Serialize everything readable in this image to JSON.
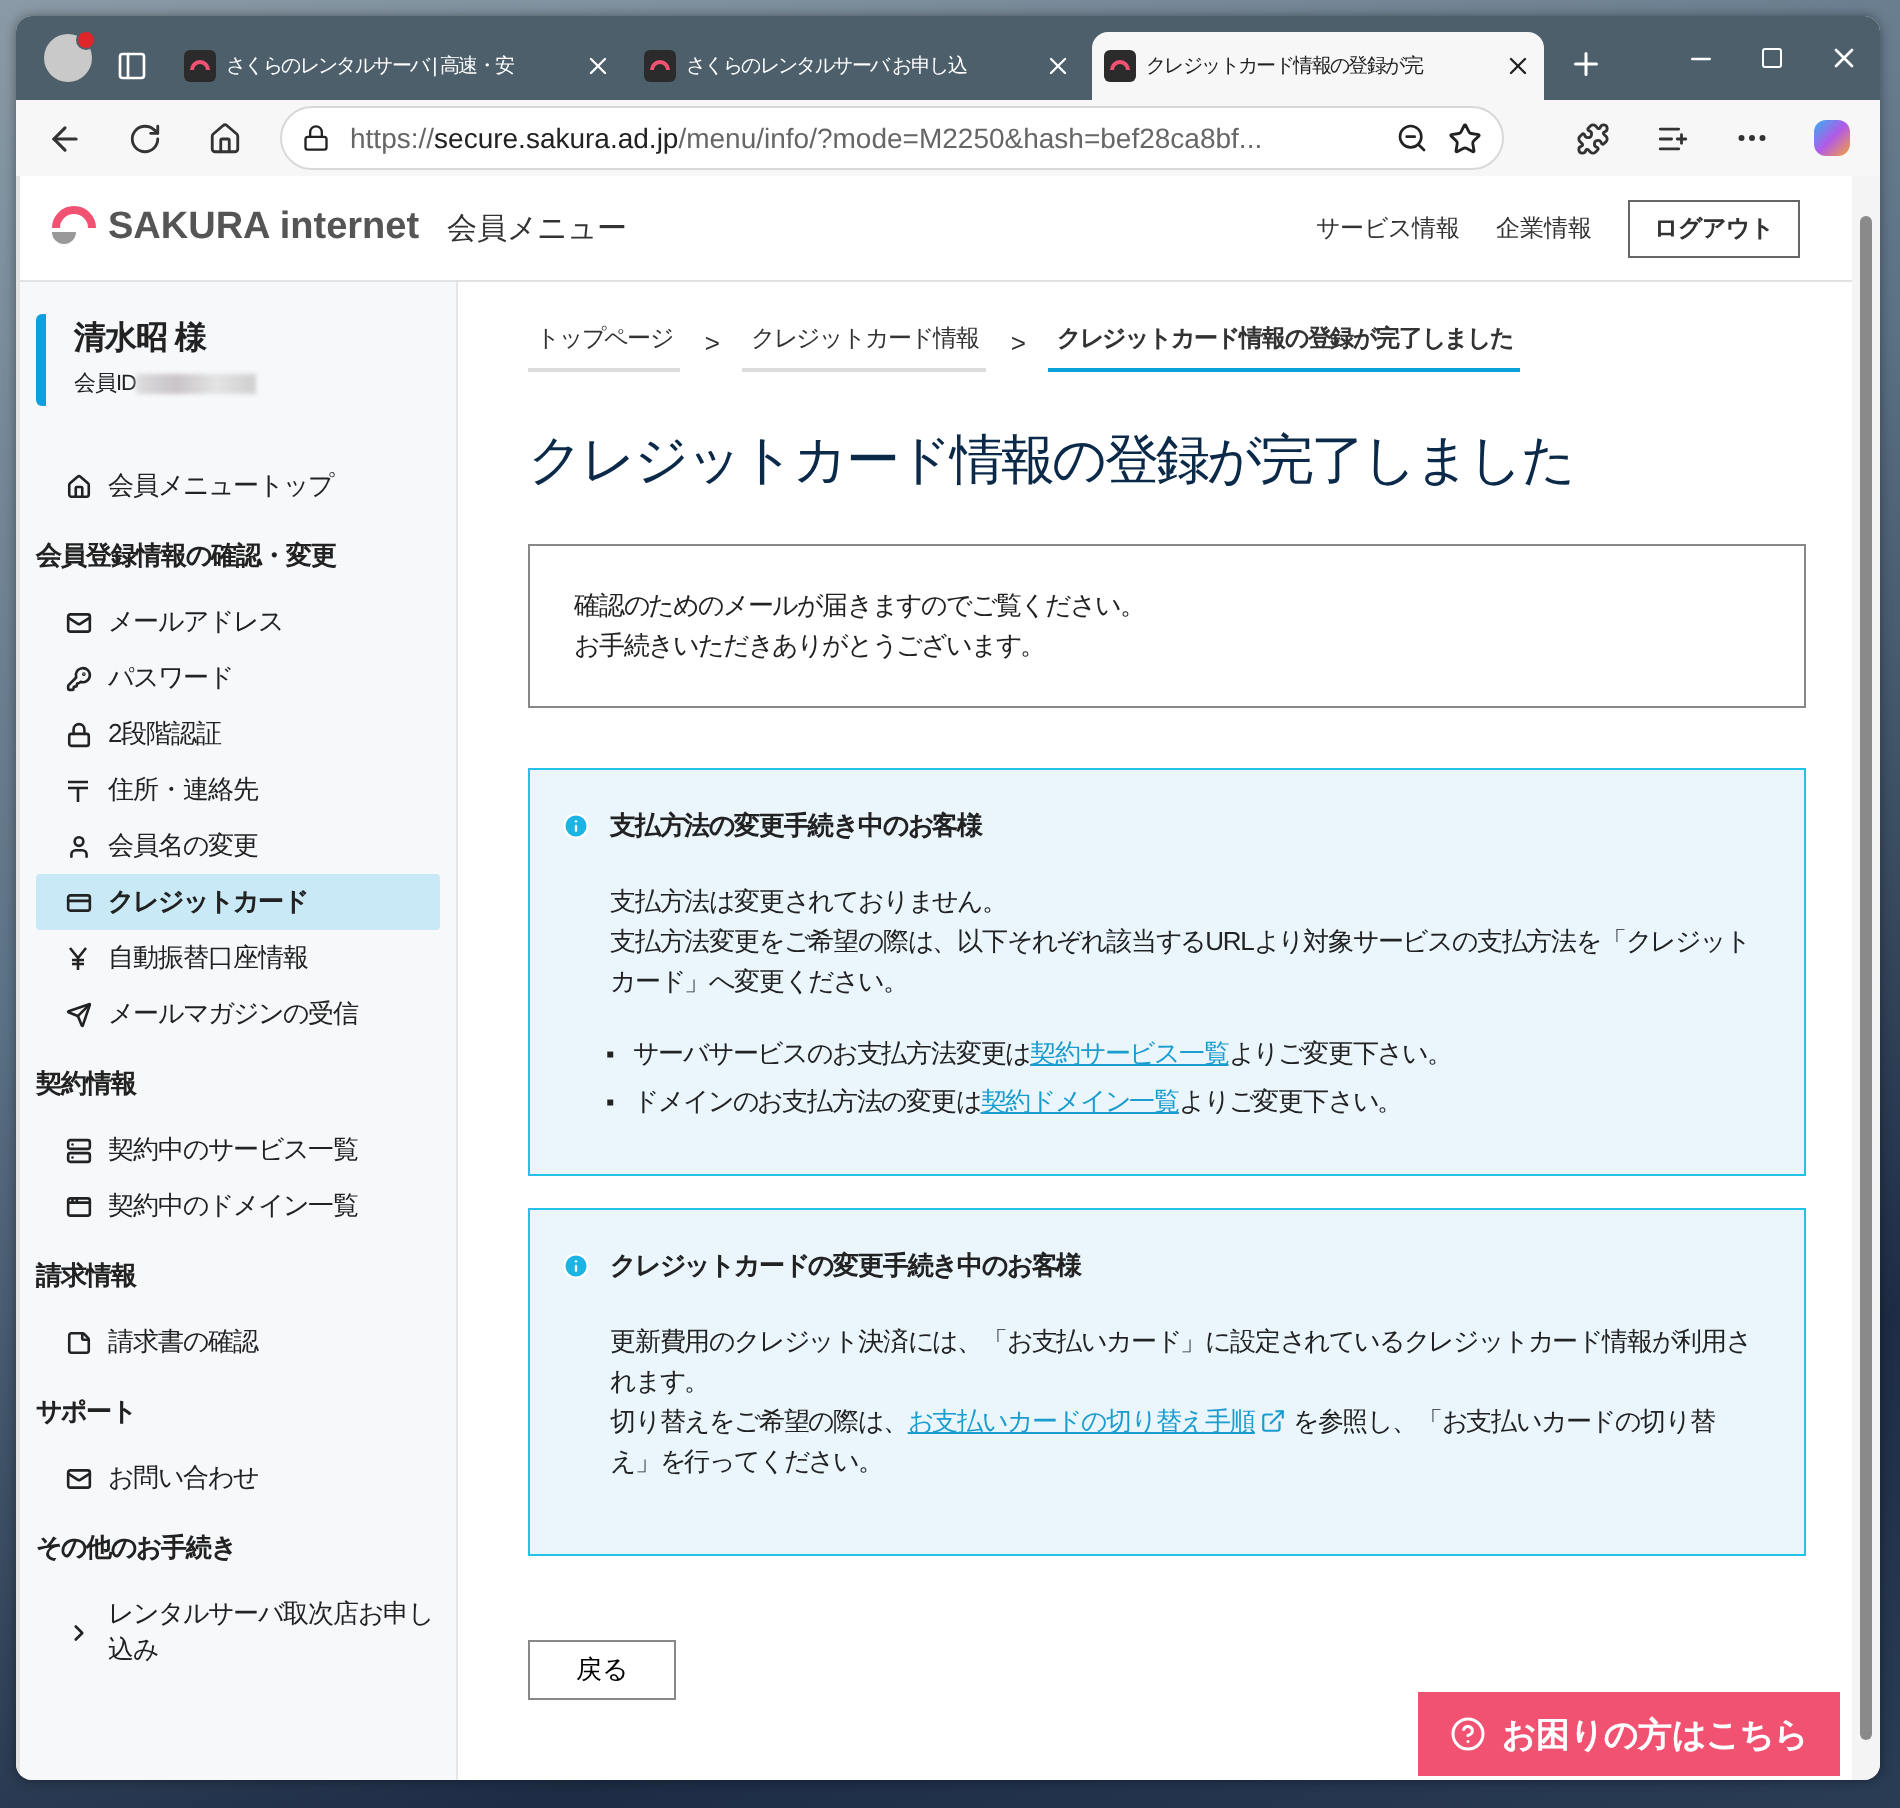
{
  "browser": {
    "tabs": [
      {
        "title": "さくらのレンタルサーバ | 高速・安",
        "selected": false
      },
      {
        "title": "さくらのレンタルサーバ お申し込",
        "selected": false
      },
      {
        "title": "クレジットカード情報の登録が完",
        "selected": true
      }
    ],
    "url": {
      "scheme": "https://",
      "host": "secure.sakura.ad.jp",
      "path": "/menu/info/?mode=M2250&hash=bef28ca8bf..."
    }
  },
  "header": {
    "logo": "SAKURA internet",
    "title": "会員メニュー",
    "links": [
      "サービス情報",
      "企業情報"
    ],
    "logout": "ログアウト"
  },
  "user": {
    "name": "清水昭 様",
    "id_label": "会員ID"
  },
  "sidebar": {
    "sections": [
      {
        "items": [
          {
            "label": "会員メニュートップ",
            "selected": false
          }
        ]
      },
      {
        "heading": "会員登録情報の確認・変更",
        "items": [
          {
            "label": "メールアドレス",
            "selected": false
          },
          {
            "label": "パスワード",
            "selected": false
          },
          {
            "label": "2段階認証",
            "selected": false
          },
          {
            "label": "住所・連絡先",
            "selected": false
          },
          {
            "label": "会員名の変更",
            "selected": false
          },
          {
            "label": "クレジットカード",
            "selected": true
          },
          {
            "label": "自動振替口座情報",
            "selected": false
          },
          {
            "label": "メールマガジンの受信",
            "selected": false
          }
        ]
      },
      {
        "heading": "契約情報",
        "items": [
          {
            "label": "契約中のサービス一覧",
            "selected": false
          },
          {
            "label": "契約中のドメイン一覧",
            "selected": false
          }
        ]
      },
      {
        "heading": "請求情報",
        "items": [
          {
            "label": "請求書の確認",
            "selected": false
          }
        ]
      },
      {
        "heading": "サポート",
        "items": [
          {
            "label": "お問い合わせ",
            "selected": false
          }
        ]
      },
      {
        "heading": "その他のお手続き",
        "items": [
          {
            "label": "レンタルサーバ取次店お申し込み",
            "selected": false
          }
        ]
      }
    ]
  },
  "breadcrumb": {
    "separator": ">",
    "items": [
      {
        "label": "トップページ",
        "selected": false
      },
      {
        "label": "クレジットカード情報",
        "selected": false
      },
      {
        "label": "クレジットカード情報の登録が完了しました",
        "selected": true
      }
    ]
  },
  "page_title": "クレジットカード情報の登録が完了しました",
  "notice": [
    "確認のためのメールが届きますのでご覧ください。",
    "お手続きいただきありがとうございます。"
  ],
  "info_boxes": [
    {
      "heading": "支払方法の変更手続き中のお客様",
      "paragraphs": [
        {
          "text": "支払方法は変更されておりません。"
        },
        {
          "text": "支払方法変更をご希望の際は、以下それぞれ該当するURLより対象サービスの支払方法を「クレジットカード」へ変更ください。"
        }
      ],
      "bullet_marker": "▪",
      "bullets": [
        {
          "text": "サーバサービスのお支払方法変更は",
          "link": "契約サービス一覧",
          "after": "よりご変更下さい。"
        },
        {
          "text": "ドメインのお支払方法の変更は",
          "link": "契約ドメイン一覧",
          "after": "よりご変更下さい。"
        }
      ]
    },
    {
      "heading": "クレジットカードの変更手続き中のお客様",
      "paragraphs": [
        {
          "text": "更新費用のクレジット決済には、「お支払いカード」に設定されているクレジットカード情報が利用されます。"
        },
        {
          "text": "切り替えをご希望の際は、",
          "link": "お支払いカードの切り替え手順",
          "external": true,
          "after": " を参照し、「お支払いカードの切り替え」を行ってください。"
        }
      ]
    }
  ],
  "back_button": "戻る",
  "help_button": "お困りの方はこちら"
}
